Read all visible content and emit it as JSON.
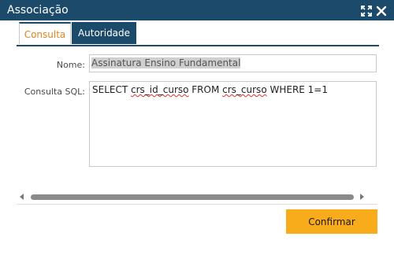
{
  "window": {
    "title": "Associação",
    "maximize_icon": "maximize-icon",
    "close_icon": "close-icon"
  },
  "tabs": [
    {
      "label": "Consulta",
      "active": true
    },
    {
      "label": "Autoridade",
      "active": false
    }
  ],
  "form": {
    "nome_label": "Nome:",
    "nome_value": "Assinatura Ensino Fundamental",
    "sql_label": "Consulta SQL:",
    "sql_parts": [
      "SELECT ",
      "crs_id_curso",
      " FROM ",
      "crs_curso",
      " WHERE 1=1"
    ]
  },
  "scrollbar": {
    "left_arrow_icon": "scroll-left-arrow-icon",
    "right_arrow_icon": "scroll-right-arrow-icon"
  },
  "actions": {
    "confirm_label": "Confirmar"
  },
  "colors": {
    "titlebar": "#1b4a6b",
    "active_tab_text": "#e2841d",
    "confirm_button": "#f9ac1b"
  }
}
